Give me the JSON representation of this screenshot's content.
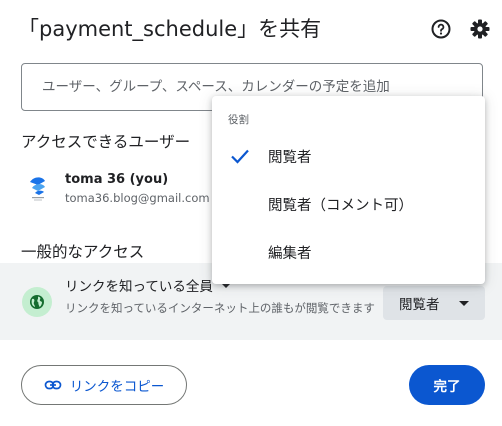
{
  "dialog": {
    "title": "「payment_schedule」を共有",
    "help_icon": "help-circle-icon",
    "settings_icon": "gear-icon"
  },
  "share": {
    "placeholder": "ユーザー、グループ、スペース、カレンダーの予定を追加"
  },
  "access": {
    "section_title": "アクセスできるユーザー",
    "users": [
      {
        "name": "toma 36 (you)",
        "email": "toma36.blog@gmail.com"
      }
    ]
  },
  "general_access": {
    "section_title": "一般的なアクセス",
    "mode": "リンクを知っている全員",
    "description": "リンクを知っているインターネット上の誰もが閲覧できます",
    "role": "閲覧者",
    "globe_color": "#c4eed0"
  },
  "role_menu": {
    "heading": "役割",
    "items": [
      {
        "label": "閲覧者",
        "selected": true
      },
      {
        "label": "閲覧者（コメント可）",
        "selected": false
      },
      {
        "label": "編集者",
        "selected": false
      }
    ]
  },
  "footer": {
    "copy_link_label": "リンクをコピー",
    "done_label": "完了"
  },
  "colors": {
    "accent": "#0b57d0",
    "row_bg": "#f1f3f4"
  }
}
